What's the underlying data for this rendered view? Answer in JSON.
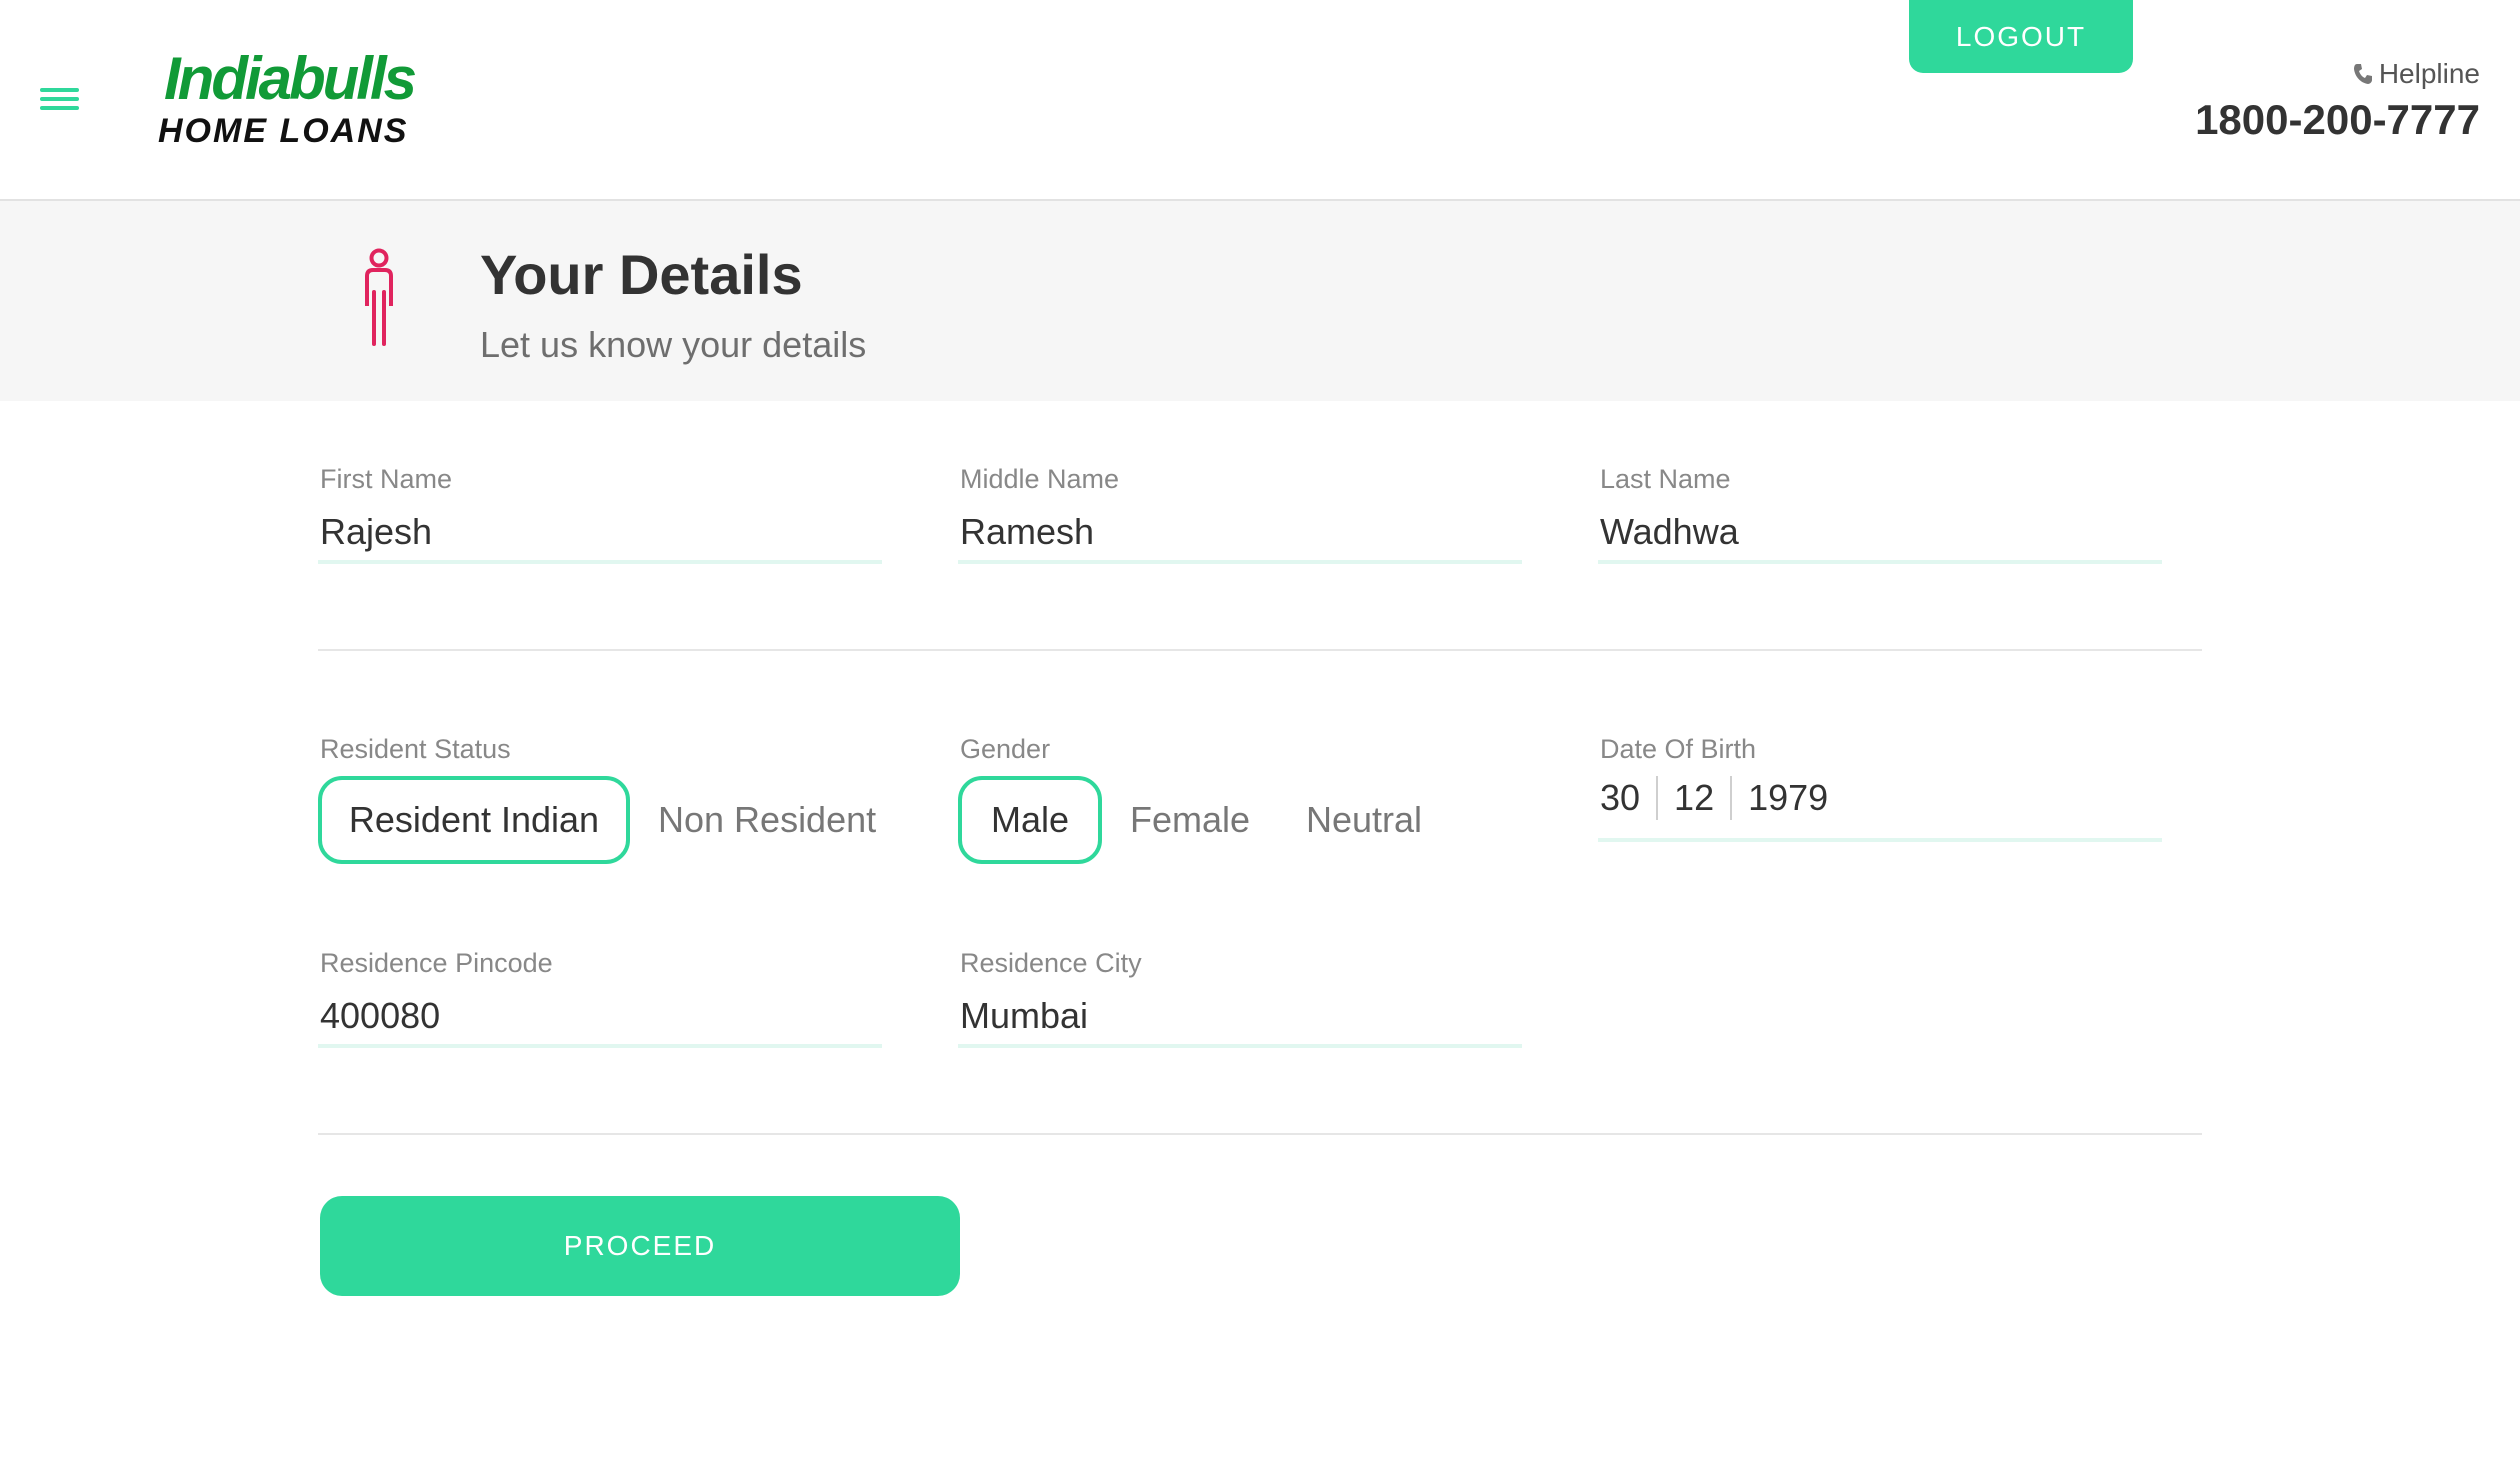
{
  "header": {
    "brand_top": "Indiabulls",
    "brand_bottom": "HOME LOANS",
    "logout_label": "LOGOUT",
    "helpline_label": "Helpline",
    "helpline_number": "1800-200-7777"
  },
  "banner": {
    "title": "Your Details",
    "subtitle": "Let us know your details"
  },
  "form": {
    "first_name": {
      "label": "First Name",
      "value": "Rajesh"
    },
    "middle_name": {
      "label": "Middle Name",
      "value": "Ramesh"
    },
    "last_name": {
      "label": "Last Name",
      "value": "Wadhwa"
    },
    "resident_status": {
      "label": "Resident Status",
      "options": [
        "Resident Indian",
        "Non Resident"
      ],
      "selected": "Resident Indian"
    },
    "gender": {
      "label": "Gender",
      "options": [
        "Male",
        "Female",
        "Neutral"
      ],
      "selected": "Male"
    },
    "date_of_birth": {
      "label": "Date Of Birth",
      "day": "30",
      "month": "12",
      "year": "1979"
    },
    "pincode": {
      "label": "Residence Pincode",
      "value": "400080"
    },
    "city": {
      "label": "Residence City",
      "value": "Mumbai"
    },
    "proceed_label": "PROCEED"
  },
  "colors": {
    "accent": "#2fd89b",
    "brand_green": "#119a37",
    "icon_pink": "#e0245e"
  },
  "icons": {
    "menu": "hamburger-menu-icon",
    "phone": "phone-icon",
    "person": "person-icon"
  }
}
